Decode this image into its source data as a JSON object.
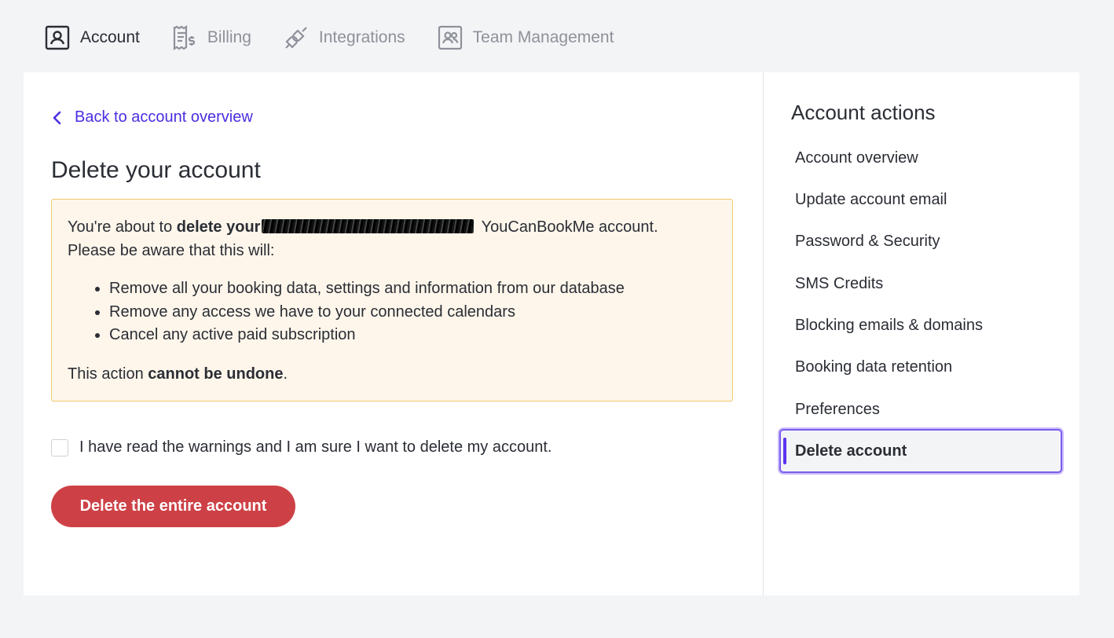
{
  "tabs": [
    {
      "label": "Account",
      "icon": "account-icon",
      "active": true
    },
    {
      "label": "Billing",
      "icon": "billing-icon",
      "active": false
    },
    {
      "label": "Integrations",
      "icon": "integrations-icon",
      "active": false
    },
    {
      "label": "Team Management",
      "icon": "team-icon",
      "active": false
    }
  ],
  "main": {
    "back_label": "Back to account overview",
    "title": "Delete your account",
    "warning": {
      "intro_prefix": "You're about to ",
      "intro_bold": "delete your",
      "intro_suffix": " YouCanBookMe account.",
      "intro_line2": "Please be aware that this will:",
      "bullets": [
        "Remove all your booking data, settings and information from our database",
        "Remove any access we have to your connected calendars",
        "Cancel any active paid subscription"
      ],
      "footer_prefix": "This action ",
      "footer_bold": "cannot be undone",
      "footer_suffix": "."
    },
    "confirm_label": "I have read the warnings and I am sure I want to delete my account.",
    "confirm_checked": false,
    "delete_button": "Delete the entire account"
  },
  "sidebar": {
    "title": "Account actions",
    "items": [
      {
        "label": "Account overview",
        "active": false
      },
      {
        "label": "Update account email",
        "active": false
      },
      {
        "label": "Password & Security",
        "active": false
      },
      {
        "label": "SMS Credits",
        "active": false
      },
      {
        "label": "Blocking emails & domains",
        "active": false
      },
      {
        "label": "Booking data retention",
        "active": false
      },
      {
        "label": "Preferences",
        "active": false
      },
      {
        "label": "Delete account",
        "active": true
      }
    ]
  },
  "colors": {
    "accent": "#4a2ee0",
    "danger": "#cd4146",
    "warning_bg": "#fef6eb",
    "warning_border": "#f1c76b",
    "active_outline": "#7b5cf0"
  }
}
